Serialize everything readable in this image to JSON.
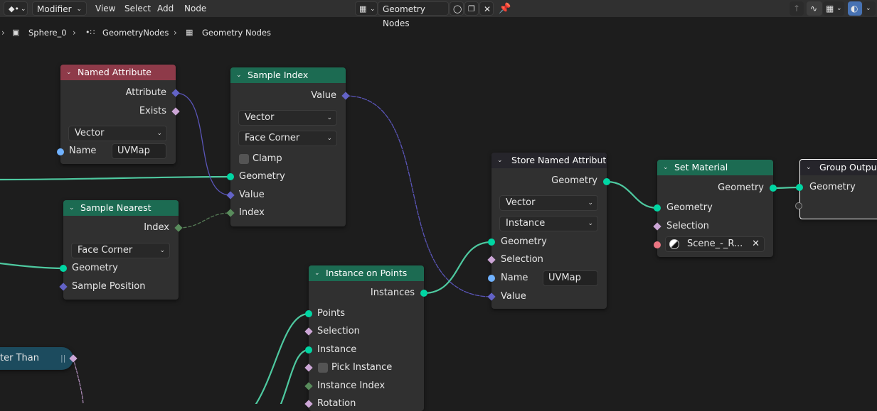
{
  "colors": {
    "geometry": "#00d6a3",
    "vector": "#6363c7",
    "float_attr": "#a1a1a1",
    "int": "#598c5c",
    "bool": "#cca6d6",
    "string": "#70b2ff",
    "material": "#eb7582",
    "header_attribute": "#8e3a49",
    "header_geometry": "#1c6b52",
    "header_output": "#26252b",
    "header_function": "#1c4b5e"
  },
  "header": {
    "mode": "Modifier",
    "menus": [
      "View",
      "Select",
      "Add",
      "Node"
    ],
    "tree_name": "Geometry Nodes",
    "icons": [
      "editor-type-icon",
      "tree-type-icon",
      "fake-user-shield-icon",
      "duplicate-icon",
      "close-icon",
      "pin-icon",
      "parent-arrow-icon",
      "wire-icon",
      "snap-icon",
      "overlay-icon"
    ]
  },
  "breadcrumbs": {
    "object": "Sphere_0",
    "modifier": "GeometryNodes",
    "tree": "Geometry Nodes"
  },
  "nodes": {
    "named_attribute": {
      "title": "Named Attribute",
      "out_attribute": "Attribute",
      "out_exists": "Exists",
      "data_type": "Vector",
      "in_name": "Name",
      "name_value": "UVMap"
    },
    "sample_index": {
      "title": "Sample Index",
      "out_value": "Value",
      "data_type": "Vector",
      "domain": "Face Corner",
      "clamp": "Clamp",
      "in_geometry": "Geometry",
      "in_value": "Value",
      "in_index": "Index"
    },
    "sample_nearest": {
      "title": "Sample Nearest",
      "out_index": "Index",
      "domain": "Face Corner",
      "in_geometry": "Geometry",
      "in_sample_position": "Sample Position"
    },
    "instance_on_points": {
      "title": "Instance on Points",
      "out_instances": "Instances",
      "in_points": "Points",
      "in_selection": "Selection",
      "in_instance": "Instance",
      "in_pick_instance": "Pick Instance",
      "in_instance_index": "Instance Index",
      "in_rotation": "Rotation"
    },
    "store_named_attribute": {
      "title": "Store Named Attribute",
      "out_geometry": "Geometry",
      "data_type": "Vector",
      "domain": "Instance",
      "in_geometry": "Geometry",
      "in_selection": "Selection",
      "in_name": "Name",
      "name_value": "UVMap",
      "in_value": "Value"
    },
    "set_material": {
      "title": "Set Material",
      "out_geometry": "Geometry",
      "in_geometry": "Geometry",
      "in_selection": "Selection",
      "material": "Scene_-_R..."
    },
    "group_output": {
      "title": "Group Outpu",
      "in_geometry": "Geometry"
    },
    "compare": {
      "title": "ter Than"
    }
  }
}
